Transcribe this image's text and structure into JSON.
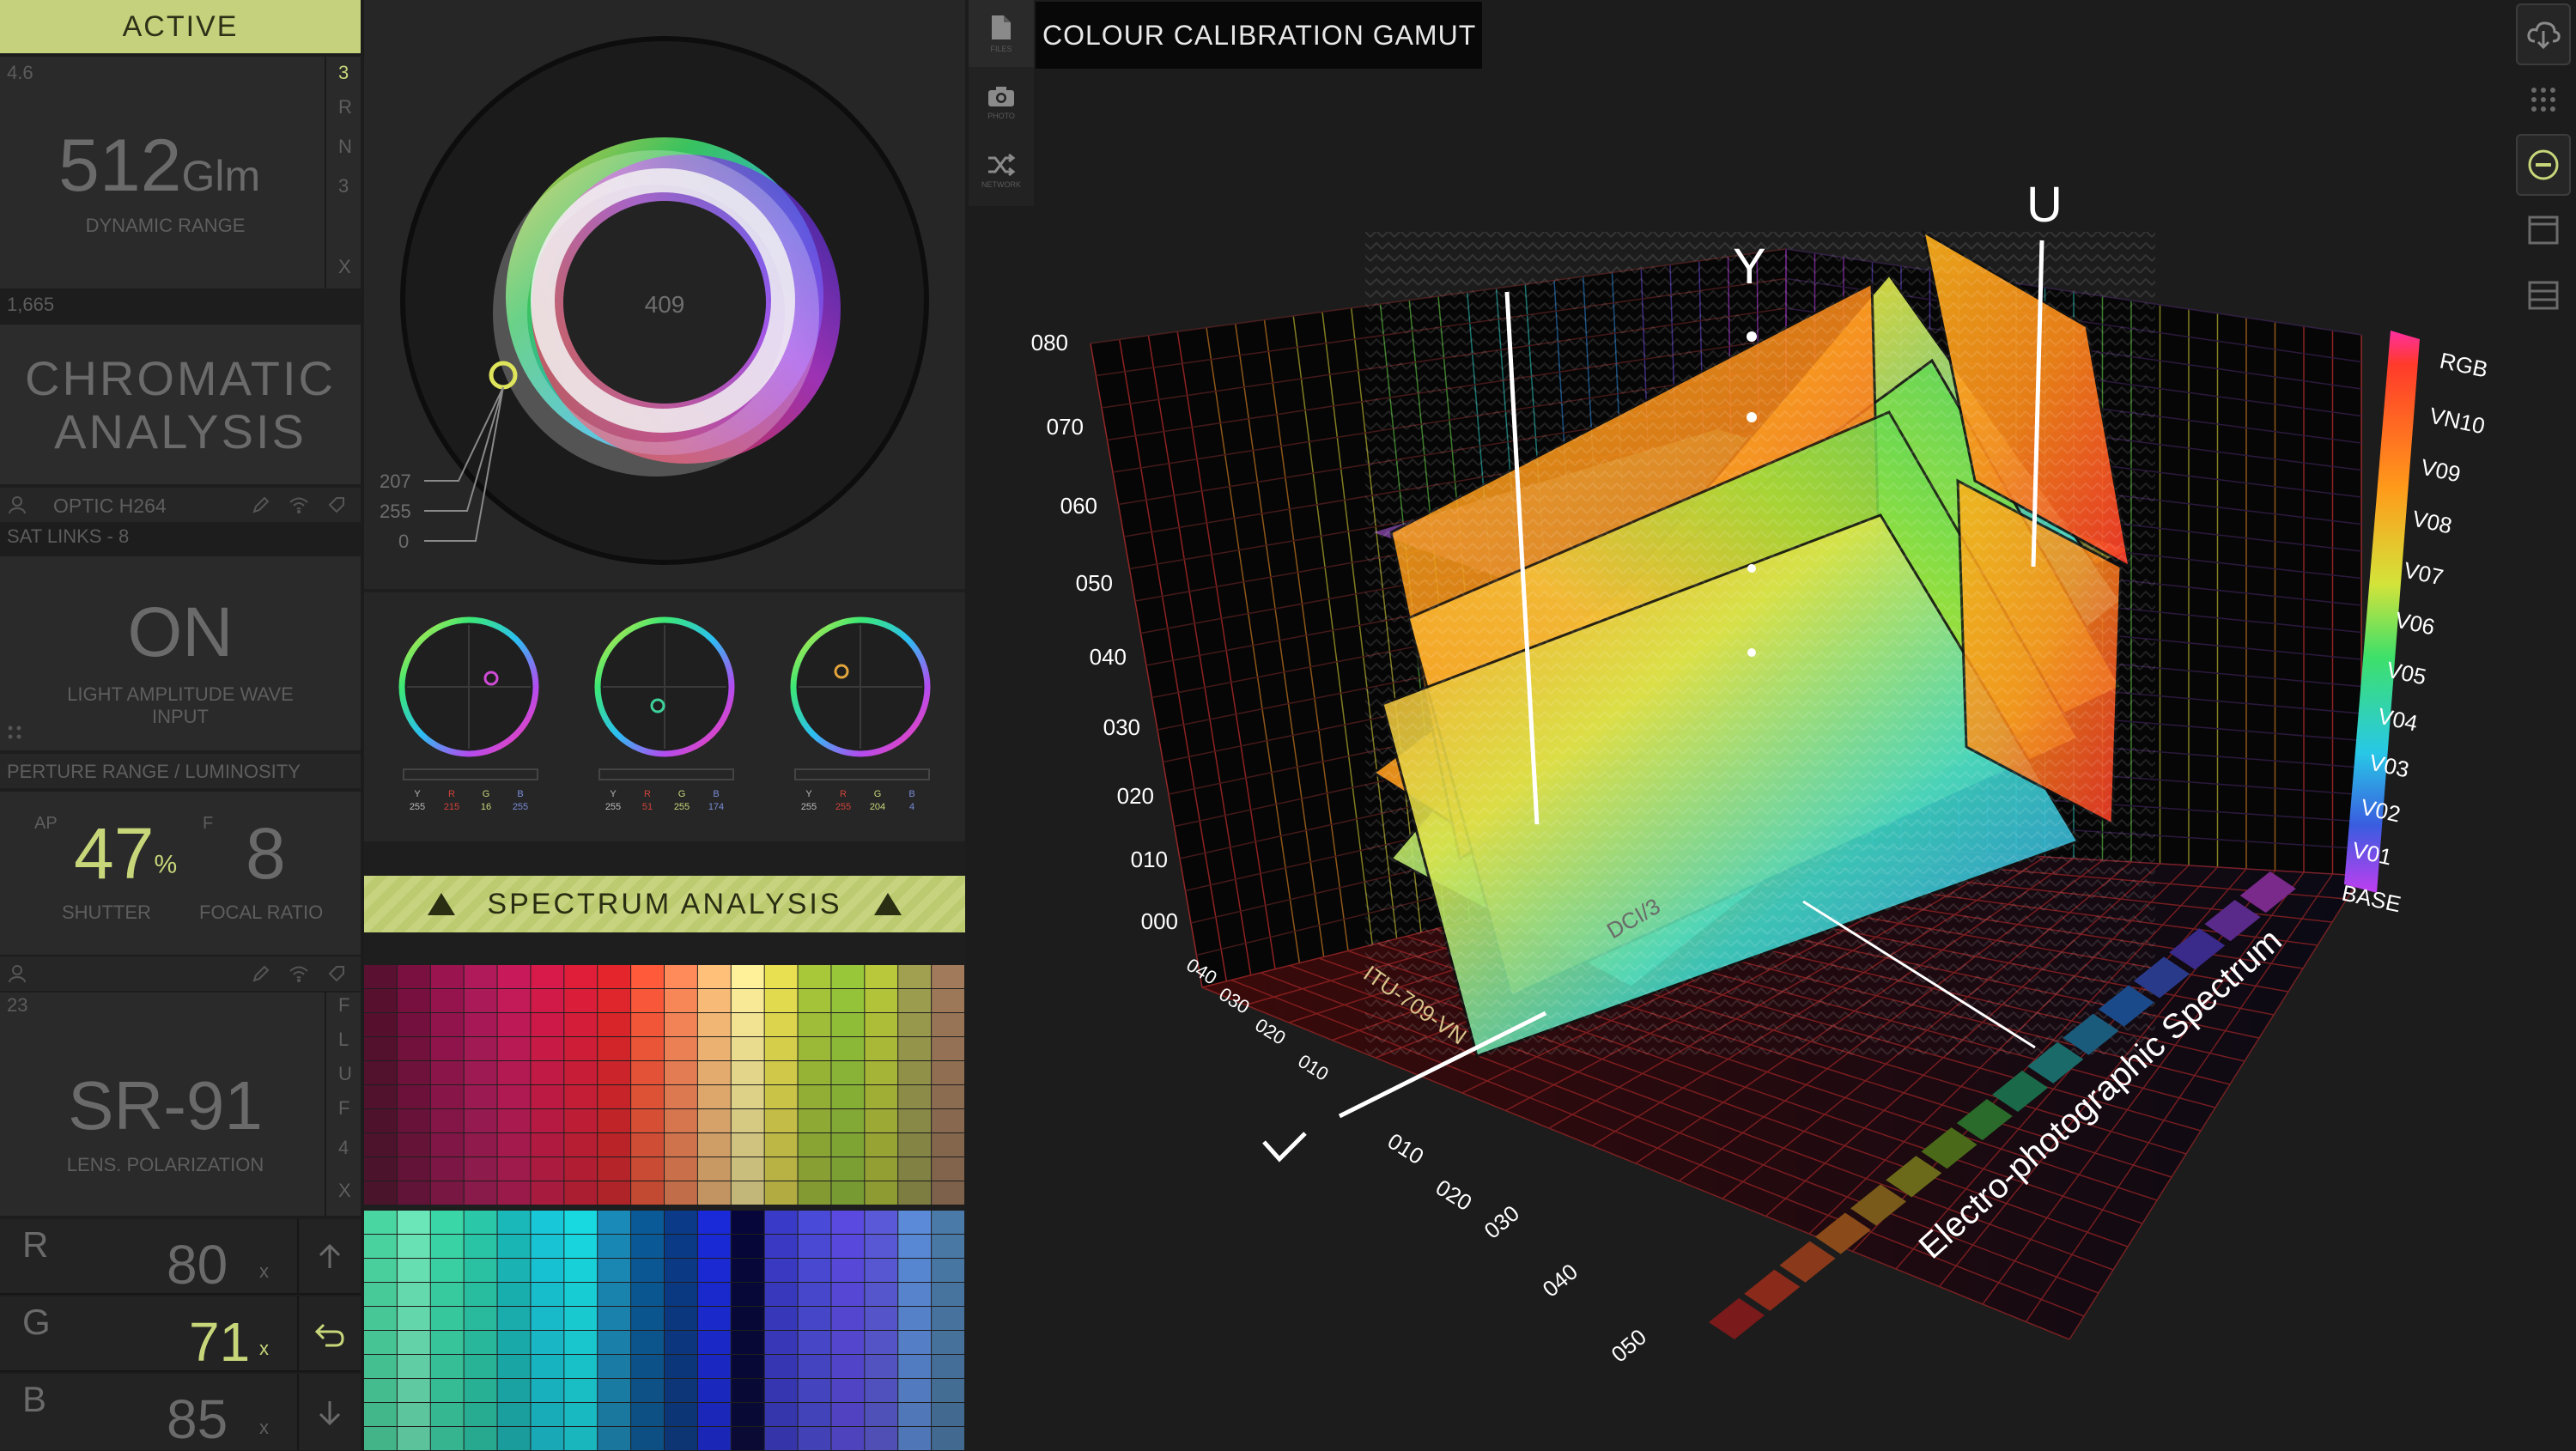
{
  "left_panel": {
    "active_label": "ACTIVE",
    "row1": {
      "left": "4.6",
      "right": "3"
    },
    "right_letters": [
      "R",
      "N",
      "3",
      "X"
    ],
    "glm_value": "512",
    "glm_unit": "Glm",
    "dynamic_range_label": "DYNAMIC RANGE",
    "row2_value": "1,665",
    "chromatic_line1": "CHROMATIC",
    "chromatic_line2": "ANALYSIS",
    "optic_label": "OPTIC H264",
    "sat_links": "SAT LINKS - 8",
    "on_value": "ON",
    "light_label_line1": "LIGHT AMPLITUDE WAVE",
    "light_label_line2": "INPUT",
    "aperture_header": "PERTURE RANGE / LUMINOSITY",
    "ap_label": "AP",
    "ap_value": "47",
    "ap_unit": "%",
    "f_label": "F",
    "f_value": "8",
    "shutter_label": "SHUTTER",
    "focal_label": "FOCAL RATIO",
    "row3_value": "23",
    "right_letters2": [
      "F",
      "L",
      "U",
      "F",
      "4",
      "X"
    ],
    "sr_value": "SR-91",
    "lens_label": "LENS. POLARIZATION",
    "rgb_rows": [
      {
        "label": "R",
        "value": "80",
        "unit": "x",
        "icon": "arrow-up-icon"
      },
      {
        "label": "G",
        "value": "71",
        "unit": "x",
        "icon": "undo-icon"
      },
      {
        "label": "B",
        "value": "85",
        "unit": "x",
        "icon": "arrow-down-icon"
      }
    ]
  },
  "middle_panel": {
    "wheel_center_value": "409",
    "wheel_readouts": [
      "207",
      "255",
      "0"
    ],
    "mini_wheels": [
      {
        "labels": [
          "Y",
          "R",
          "G",
          "B"
        ],
        "values": [
          "255",
          "215",
          "16",
          "255"
        ]
      },
      {
        "labels": [
          "Y",
          "R",
          "G",
          "B"
        ],
        "values": [
          "255",
          "51",
          "255",
          "174"
        ]
      },
      {
        "labels": [
          "Y",
          "R",
          "G",
          "B"
        ],
        "values": [
          "255",
          "255",
          "204",
          "4"
        ]
      }
    ],
    "spectrum_title": "SPECTRUM ANALYSIS"
  },
  "toolbar": {
    "items": [
      {
        "name": "files",
        "label": "FILES",
        "icon": "file-icon"
      },
      {
        "name": "photo",
        "label": "PHOTO",
        "icon": "camera-icon"
      },
      {
        "name": "network",
        "label": "NETWORK",
        "icon": "shuffle-icon"
      }
    ]
  },
  "chart": {
    "title": "COLOUR CALIBRATION GAMUT",
    "axis_y_ticks": [
      "080",
      "070",
      "060",
      "050",
      "040",
      "030",
      "020",
      "010",
      "000"
    ],
    "axis_x_ticks": [
      "040",
      "030",
      "020",
      "010"
    ],
    "axis_z_ticks": [
      "010",
      "020",
      "030",
      "040",
      "050"
    ],
    "axis_letters": [
      "Y",
      "U",
      "L"
    ],
    "legend_labels": [
      "RGB",
      "VN10",
      "V09",
      "V08",
      "V07",
      "V06",
      "V05",
      "V04",
      "V03",
      "V02",
      "V01",
      "BASE"
    ],
    "spectrum_label": "Electro-photographic Spectrum",
    "surface_labels": [
      "ITU-709-VN",
      "DCI/3"
    ]
  },
  "right_tools": [
    "cloud-download-icon",
    "grid-dots-icon",
    "minus-circle-icon",
    "window-icon",
    "server-icon"
  ],
  "colors": {
    "accent": "#c8d67a",
    "panel": "#2a2a2a",
    "background": "#1c1c1c"
  }
}
